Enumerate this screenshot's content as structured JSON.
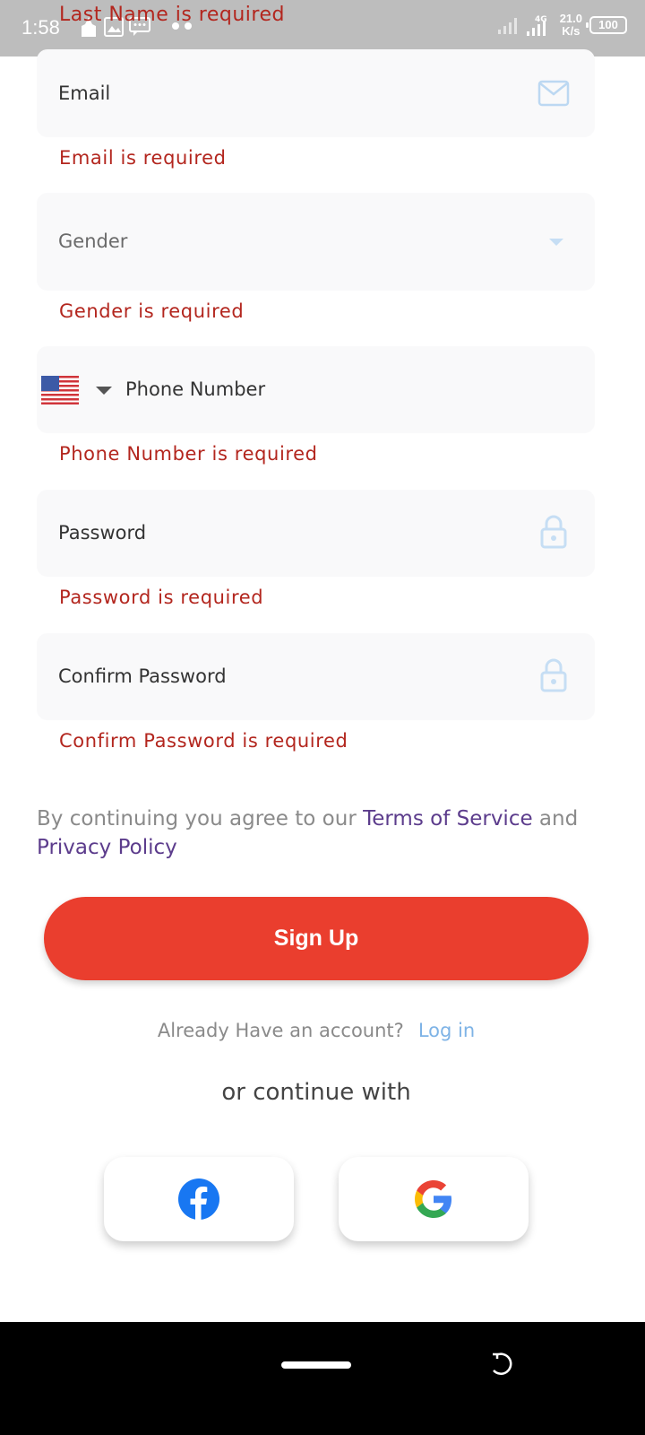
{
  "status_bar": {
    "time": "1:58",
    "net_speed_value": "21.0",
    "net_speed_unit": "K/s",
    "network": "4G",
    "battery": "100"
  },
  "errors": {
    "last_name": "Last Name is required",
    "email": "Email is required",
    "gender": "Gender is required",
    "phone": "Phone Number is required",
    "password": "Password is required",
    "confirm_password": "Confirm Password is required"
  },
  "fields": {
    "email_label": "Email",
    "gender_label": "Gender",
    "phone_label": "Phone Number",
    "password_label": "Password",
    "confirm_password_label": "Confirm Password"
  },
  "terms": {
    "prefix": "By continuing you agree to our ",
    "terms_link": "Terms of Service",
    "middle": " and ",
    "privacy_link": "Privacy Policy"
  },
  "signup_button": "Sign Up",
  "login_prompt": {
    "text": "Already Have an account?",
    "link": "Log in"
  },
  "continue_text": "or continue with",
  "colors": {
    "primary": "#ea3e2e",
    "error": "#b3261e",
    "link": "#5c3c8c",
    "login_link": "#7eb3e6",
    "field_bg": "#f9f9fa"
  },
  "icons": {
    "email": "mail-icon",
    "gender": "dropdown-arrow-icon",
    "country": "us-flag-icon",
    "password": "lock-icon",
    "facebook": "facebook-icon",
    "google": "google-icon"
  }
}
